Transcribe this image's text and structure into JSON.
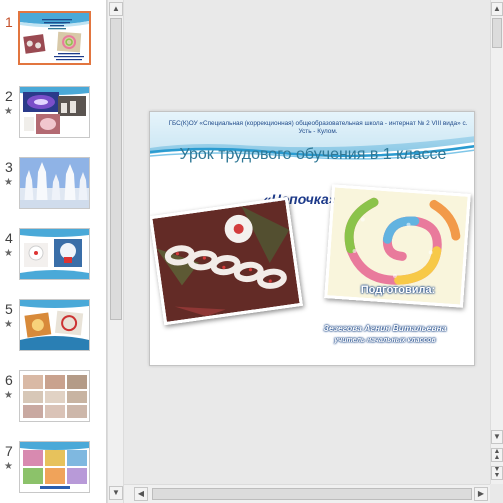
{
  "thumbnails": [
    {
      "number": "1",
      "has_animation": false,
      "active": true
    },
    {
      "number": "2",
      "has_animation": true,
      "active": false
    },
    {
      "number": "3",
      "has_animation": true,
      "active": false
    },
    {
      "number": "4",
      "has_animation": true,
      "active": false
    },
    {
      "number": "5",
      "has_animation": true,
      "active": false
    },
    {
      "number": "6",
      "has_animation": true,
      "active": false
    },
    {
      "number": "7",
      "has_animation": true,
      "active": false
    }
  ],
  "animation_mark": "★",
  "slide": {
    "school": "ГБС(К)ОУ «Специальная (коррекционная) общеобразовательная школа - интернат № 2 VIII вида» с. Усть - Кулом.",
    "title": "Урок трудового обучения в 1 классе",
    "topic": "«Цепочка»",
    "prepared_by": "Подготовила:",
    "author": "Зезегова Агния Витальевна",
    "author_role": "учитель начальных классов"
  },
  "colors": {
    "accent": "#e2753f",
    "title": "#2f7896",
    "topic": "#1d3a8a",
    "header_band": "#2a9bd0"
  }
}
